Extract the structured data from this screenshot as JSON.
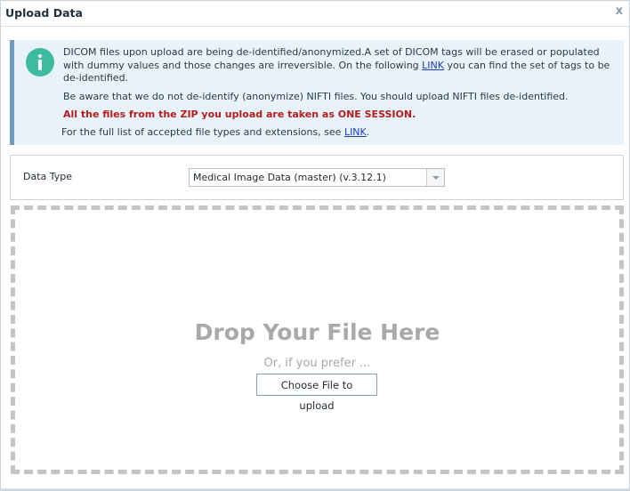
{
  "dialog": {
    "title": "Upload Data",
    "close_label": "x"
  },
  "info": {
    "icon": "info-icon",
    "paragraph1_text": "DICOM files upon upload are being de-identified/anonymized.A set of DICOM tags will be erased or populated with dummy values and those changes are irreversible. On the following ",
    "paragraph1_link": "LINK",
    "paragraph1_suffix": " you can find the set of tags to be de-identified.",
    "paragraph2": "Be aware that we do not de-identify (anonymize) NIFTI files. You should upload NIFTI files de-identified.",
    "warning": "All the files from the ZIP you upload are taken as ONE SESSION.",
    "paragraph4_text": "For the full list of accepted file types and extensions, see ",
    "paragraph4_link": "LINK",
    "paragraph4_suffix": "."
  },
  "form": {
    "data_type_label": "Data Type",
    "data_type_value": "Medical Image Data (master) (v.3.12.1)"
  },
  "dropzone": {
    "title": "Drop Your File Here",
    "subtitle": "Or, if you prefer ...",
    "button_label": "Choose File to upload"
  },
  "colors": {
    "accent_teal": "#3dbb9e",
    "info_bg": "#e8f2fa",
    "info_border": "#6f9bbd",
    "warning_red": "#b31d1d",
    "link_blue": "#1a3fb8"
  }
}
